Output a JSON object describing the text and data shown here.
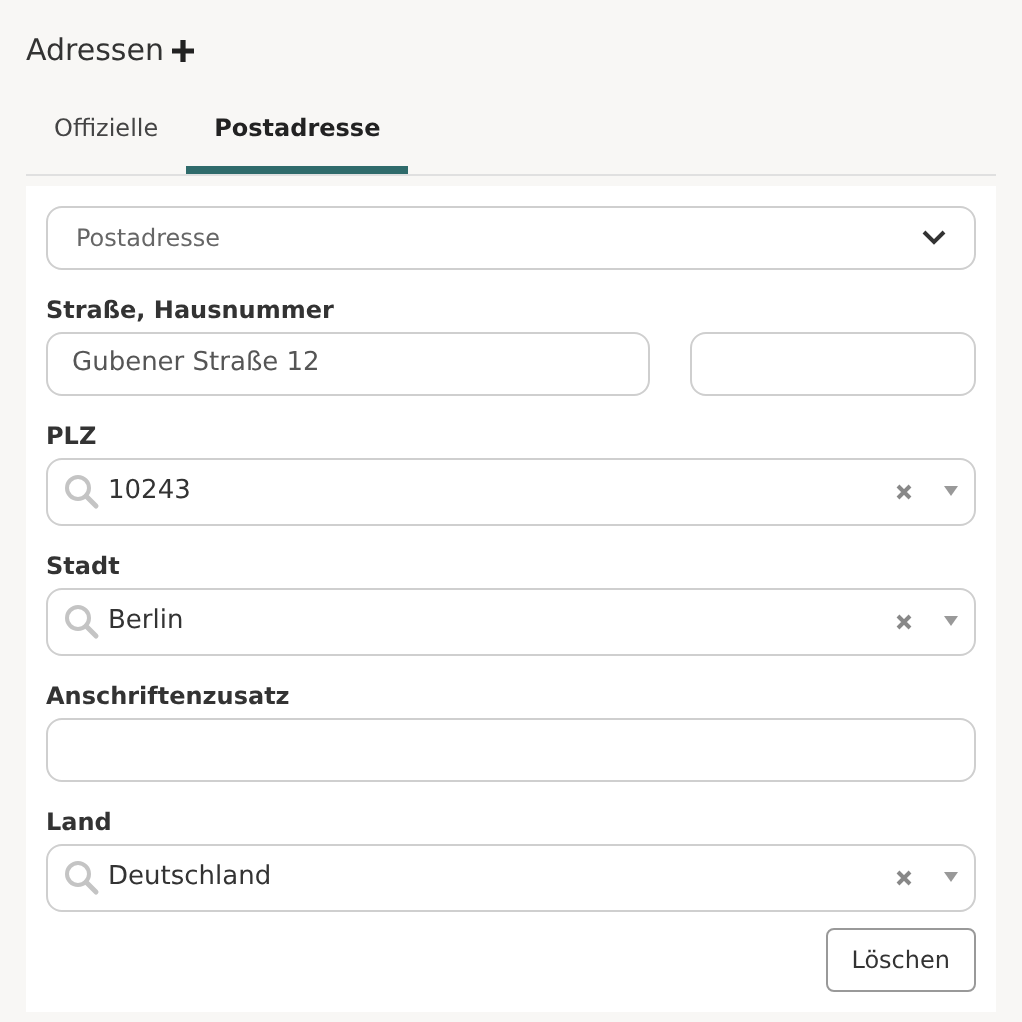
{
  "title": "Adressen",
  "tabs": [
    {
      "label": "Offizielle",
      "selected": false
    },
    {
      "label": "Postadresse",
      "selected": true
    }
  ],
  "address_type": {
    "value": "Postadresse"
  },
  "fields": [
    {
      "kind": "pair",
      "label": "Straße, Hausnummer",
      "value": "Gubener Straße 12"
    },
    {
      "kind": "search",
      "label": "PLZ",
      "value": "10243"
    },
    {
      "kind": "search",
      "label": "Stadt",
      "value": "Berlin"
    },
    {
      "kind": "text",
      "label": "Anschriftenzusatz"
    },
    {
      "kind": "search",
      "label": "Land",
      "value": "Deutschland"
    }
  ],
  "buttons": [
    "Löschen"
  ]
}
